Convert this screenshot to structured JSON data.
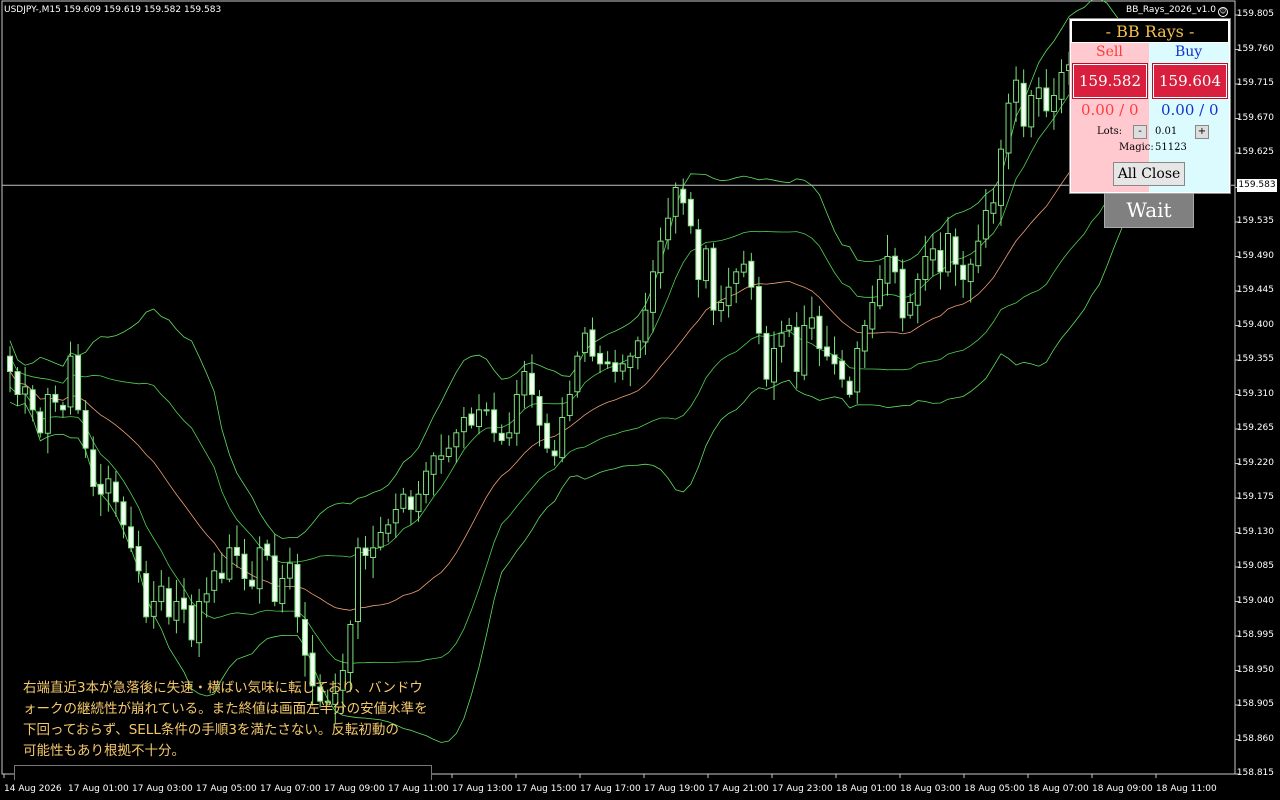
{
  "header": {
    "symbol_info": "USDJPY-,M15  159.609 159.619 159.582 159.583",
    "ea_name": "BB_Rays_2026_v1.0"
  },
  "y_axis": {
    "labels": [
      "159.805",
      "159.760",
      "159.715",
      "159.670",
      "159.625",
      "159.580",
      "159.535",
      "159.490",
      "159.445",
      "159.400",
      "159.355",
      "159.310",
      "159.265",
      "159.220",
      "159.175",
      "159.130",
      "159.085",
      "159.040",
      "158.995",
      "158.950",
      "158.905",
      "158.860",
      "158.815"
    ],
    "current_price": "159.583"
  },
  "x_axis": {
    "labels": [
      "14 Aug 2026",
      "17 Aug 01:00",
      "17 Aug 03:00",
      "17 Aug 05:00",
      "17 Aug 07:00",
      "17 Aug 09:00",
      "17 Aug 11:00",
      "17 Aug 13:00",
      "17 Aug 15:00",
      "17 Aug 17:00",
      "17 Aug 19:00",
      "17 Aug 21:00",
      "17 Aug 23:00",
      "18 Aug 01:00",
      "18 Aug 03:00",
      "18 Aug 05:00",
      "18 Aug 07:00",
      "18 Aug 09:00",
      "18 Aug 11:00"
    ]
  },
  "panel": {
    "title": "- BB Rays -",
    "sell_label": "Sell",
    "buy_label": "Buy",
    "sell_price": "159.582",
    "buy_price": "159.604",
    "sell_pl": "0.00 / 0",
    "buy_pl": "0.00 / 0",
    "lots_label": "Lots:",
    "minus": "-",
    "plus": "+",
    "lots_value": "0.01",
    "magic_label": "Magic:",
    "magic_value": "51123",
    "all_close": "All Close",
    "colors": {
      "sell": "#ff3b3b",
      "buy": "#1133cc",
      "button": "#d8203e"
    }
  },
  "wait_button": "Wait",
  "comment": {
    "lines": [
      "右端直近3本が急落後に失速・横ばい気味に転じており、バンドウ",
      "ォークの継続性が崩れている。また終値は画面左半分の安値水準を",
      "下回っておらず、SELL条件の手順3を満たさない。反転初動の",
      "可能性もあり根拠不十分。"
    ],
    "color": "#f5c96b"
  },
  "chart_data": {
    "type": "candlestick",
    "timeframe": "M15",
    "ylim": [
      158.815,
      159.805
    ],
    "current_price": 159.583,
    "close": [
      159.34,
      159.31,
      159.32,
      159.29,
      159.26,
      159.31,
      159.3,
      159.29,
      159.36,
      159.29,
      159.24,
      159.19,
      159.18,
      159.2,
      159.17,
      159.14,
      159.11,
      159.08,
      159.02,
      159.04,
      159.06,
      159.02,
      159.04,
      159.03,
      158.99,
      159.04,
      159.05,
      159.08,
      159.07,
      159.11,
      159.1,
      159.07,
      159.06,
      159.11,
      159.1,
      159.04,
      159.07,
      159.09,
      159.02,
      158.97,
      158.93,
      158.91,
      158.91,
      158.92,
      158.95,
      159.01,
      159.11,
      159.1,
      159.11,
      159.13,
      159.14,
      159.16,
      159.18,
      159.16,
      159.18,
      159.21,
      159.23,
      159.23,
      159.24,
      159.26,
      159.28,
      159.27,
      159.29,
      159.29,
      159.26,
      159.25,
      159.26,
      159.31,
      159.34,
      159.31,
      159.27,
      159.24,
      159.23,
      159.28,
      159.31,
      159.36,
      159.39,
      159.36,
      159.35,
      159.35,
      159.34,
      159.35,
      159.36,
      159.38,
      159.42,
      159.47,
      159.51,
      159.54,
      159.58,
      159.56,
      159.53,
      159.46,
      159.5,
      159.42,
      159.43,
      159.45,
      159.47,
      159.48,
      159.45,
      159.39,
      159.33,
      159.37,
      159.39,
      159.4,
      159.34,
      159.4,
      159.41,
      159.37,
      159.36,
      159.35,
      159.33,
      159.31,
      159.37,
      159.4,
      159.43,
      159.46,
      159.49,
      159.47,
      159.41,
      159.43,
      159.46,
      159.49,
      159.5,
      159.47,
      159.52,
      159.48,
      159.46,
      159.48,
      159.51,
      159.55,
      159.56,
      159.63,
      159.69,
      159.72,
      159.66,
      159.7,
      159.71,
      159.68,
      159.7,
      159.73,
      159.74,
      159.69,
      159.68,
      159.75,
      159.68,
      159.66,
      159.58,
      159.59
    ]
  }
}
